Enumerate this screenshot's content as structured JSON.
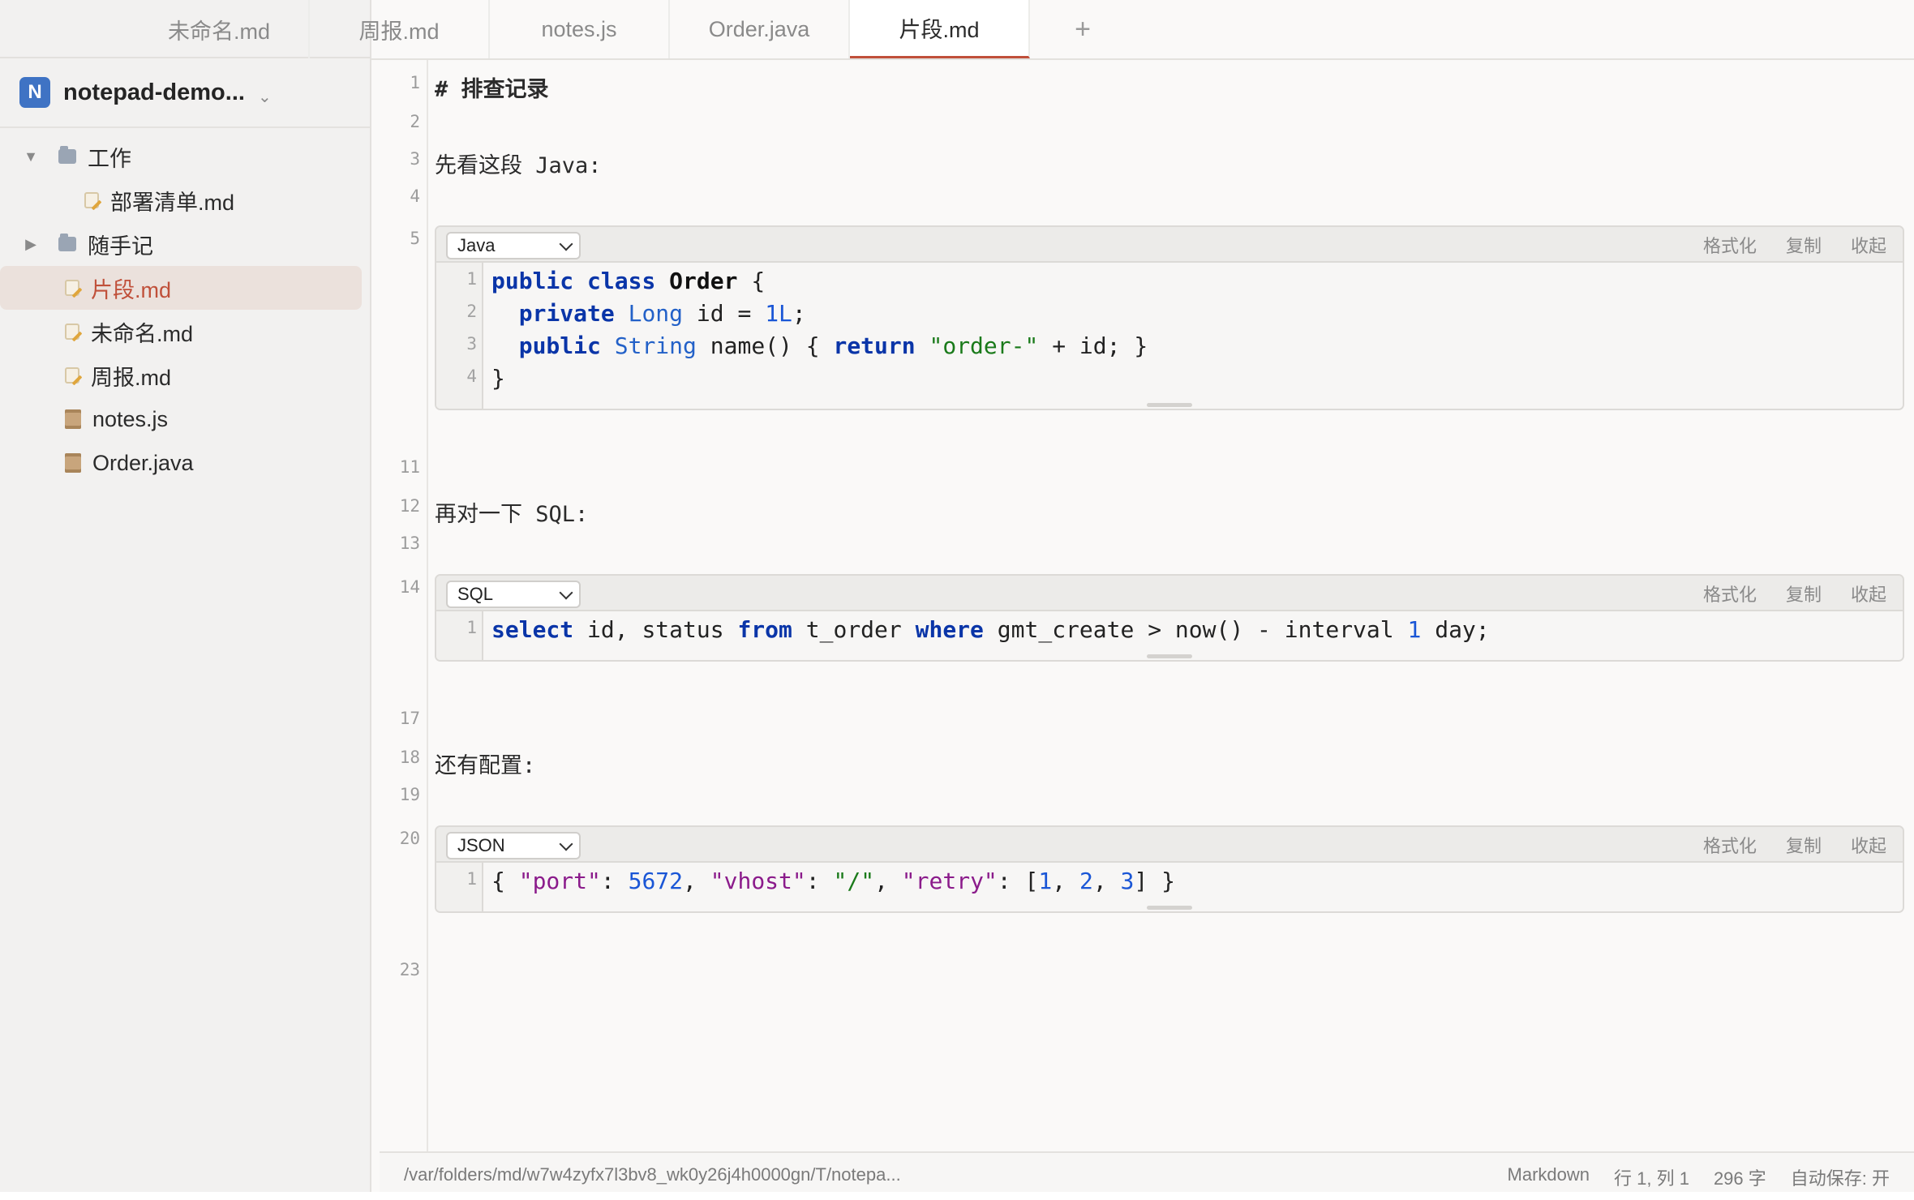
{
  "tabs": [
    {
      "label": "未命名.md",
      "active": false
    },
    {
      "label": "周报.md",
      "active": false
    },
    {
      "label": "notes.js",
      "active": false
    },
    {
      "label": "Order.java",
      "active": false
    },
    {
      "label": "片段.md",
      "active": true
    }
  ],
  "tab_add_label": "+",
  "workspace": {
    "badge": "N",
    "name": "notepad-demo...",
    "chevron": "⌄"
  },
  "tree": [
    {
      "label": "工作",
      "type": "folder",
      "expanded": true,
      "icon": "folder-icon"
    },
    {
      "label": "部署清单.md",
      "type": "note",
      "icon": "note-icon"
    },
    {
      "label": "随手记",
      "type": "folder",
      "expanded": false,
      "icon": "folder-icon"
    },
    {
      "label": "片段.md",
      "type": "note",
      "selected": true,
      "icon": "note-icon"
    },
    {
      "label": "未命名.md",
      "type": "note",
      "icon": "note-icon"
    },
    {
      "label": "周报.md",
      "type": "note",
      "icon": "note-icon"
    },
    {
      "label": "notes.js",
      "type": "code",
      "icon": "code-file-icon"
    },
    {
      "label": "Order.java",
      "type": "code",
      "icon": "code-file-icon"
    }
  ],
  "editor": {
    "line_numbers": [
      "1",
      "2",
      "3",
      "4",
      "5",
      "11",
      "12",
      "13",
      "14",
      "17",
      "18",
      "19",
      "20",
      "23"
    ],
    "heading": "# 排查记录",
    "para1": "先看这段 Java:",
    "para2": "再对一下 SQL:",
    "para3": "还有配置:"
  },
  "code_actions": {
    "format": "格式化",
    "copy": "复制",
    "collapse": "收起"
  },
  "code_blocks": [
    {
      "language": "Java",
      "line_numbers": [
        "1",
        "2",
        "3",
        "4"
      ]
    },
    {
      "language": "SQL",
      "line_numbers": [
        "1"
      ]
    },
    {
      "language": "JSON",
      "line_numbers": [
        "1"
      ]
    }
  ],
  "code": {
    "java": [
      [
        {
          "t": "public",
          "c": "kw"
        },
        {
          "t": " "
        },
        {
          "t": "class",
          "c": "kw"
        },
        {
          "t": " "
        },
        {
          "t": "Order",
          "c": "cls"
        },
        {
          "t": " {"
        }
      ],
      [
        {
          "t": "  "
        },
        {
          "t": "private",
          "c": "kw"
        },
        {
          "t": " "
        },
        {
          "t": "Long",
          "c": "ty"
        },
        {
          "t": " id = "
        },
        {
          "t": "1L",
          "c": "num"
        },
        {
          "t": ";"
        }
      ],
      [
        {
          "t": "  "
        },
        {
          "t": "public",
          "c": "kw"
        },
        {
          "t": " "
        },
        {
          "t": "String",
          "c": "ty"
        },
        {
          "t": " name() { "
        },
        {
          "t": "return",
          "c": "kw"
        },
        {
          "t": " "
        },
        {
          "t": "\"order-\"",
          "c": "str"
        },
        {
          "t": " + id; }"
        }
      ],
      [
        {
          "t": "}"
        }
      ]
    ],
    "sql": [
      [
        {
          "t": "select",
          "c": "kw"
        },
        {
          "t": " id, status "
        },
        {
          "t": "from",
          "c": "kw"
        },
        {
          "t": " t_order "
        },
        {
          "t": "where",
          "c": "kw"
        },
        {
          "t": " gmt_create > now() - interval "
        },
        {
          "t": "1",
          "c": "num"
        },
        {
          "t": " day;"
        }
      ]
    ],
    "json": [
      [
        {
          "t": "{ "
        },
        {
          "t": "\"port\"",
          "c": "key"
        },
        {
          "t": ": "
        },
        {
          "t": "5672",
          "c": "num"
        },
        {
          "t": ", "
        },
        {
          "t": "\"vhost\"",
          "c": "key"
        },
        {
          "t": ": "
        },
        {
          "t": "\"/\"",
          "c": "str"
        },
        {
          "t": ", "
        },
        {
          "t": "\"retry\"",
          "c": "key"
        },
        {
          "t": ": ["
        },
        {
          "t": "1",
          "c": "num"
        },
        {
          "t": ", "
        },
        {
          "t": "2",
          "c": "num"
        },
        {
          "t": ", "
        },
        {
          "t": "3",
          "c": "num"
        },
        {
          "t": "] }"
        }
      ]
    ]
  },
  "status": {
    "path": "/var/folders/md/w7w4zyfx7l3bv8_wk0y26j4h0000gn/T/notepa...",
    "mode": "Markdown",
    "position": "行 1, 列 1",
    "chars": "296 字",
    "autosave": "自动保存: 开"
  }
}
